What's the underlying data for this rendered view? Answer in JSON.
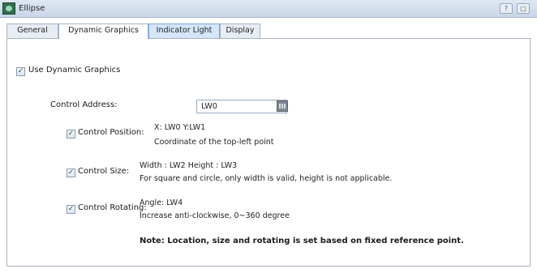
{
  "window": {
    "title": "Ellipse",
    "buttons": [
      "?",
      "□"
    ]
  },
  "tabs": [
    {
      "label": "General",
      "state": "normal"
    },
    {
      "label": "Dynamic Graphics",
      "state": "active"
    },
    {
      "label": "Indicator Light",
      "state": "focused"
    },
    {
      "label": "Display",
      "state": "normal"
    }
  ],
  "use_dynamic": {
    "label": "Use Dynamic Graphics",
    "checked": true,
    "check_glyph": "✓"
  },
  "control_address": {
    "label": "Control Address:",
    "value": "LW0",
    "picker_icon": "address-picker-icon"
  },
  "rows": [
    {
      "label": "Control Position:",
      "checked": true,
      "line1": "X: LW0   Y:LW1",
      "line2": "Coordinate of the top-left point"
    },
    {
      "label": "Control Size:",
      "checked": true,
      "line1": "Width : LW2   Height : LW3",
      "line2": "For square and circle, only width is valid, height is not applicable."
    },
    {
      "label": "Control Rotating:",
      "checked": true,
      "line1": "Angle: LW4",
      "line2": "Increase anti-clockwise, 0~360 degree"
    }
  ],
  "note": "Note: Location, size and rotating is set based on fixed reference point."
}
